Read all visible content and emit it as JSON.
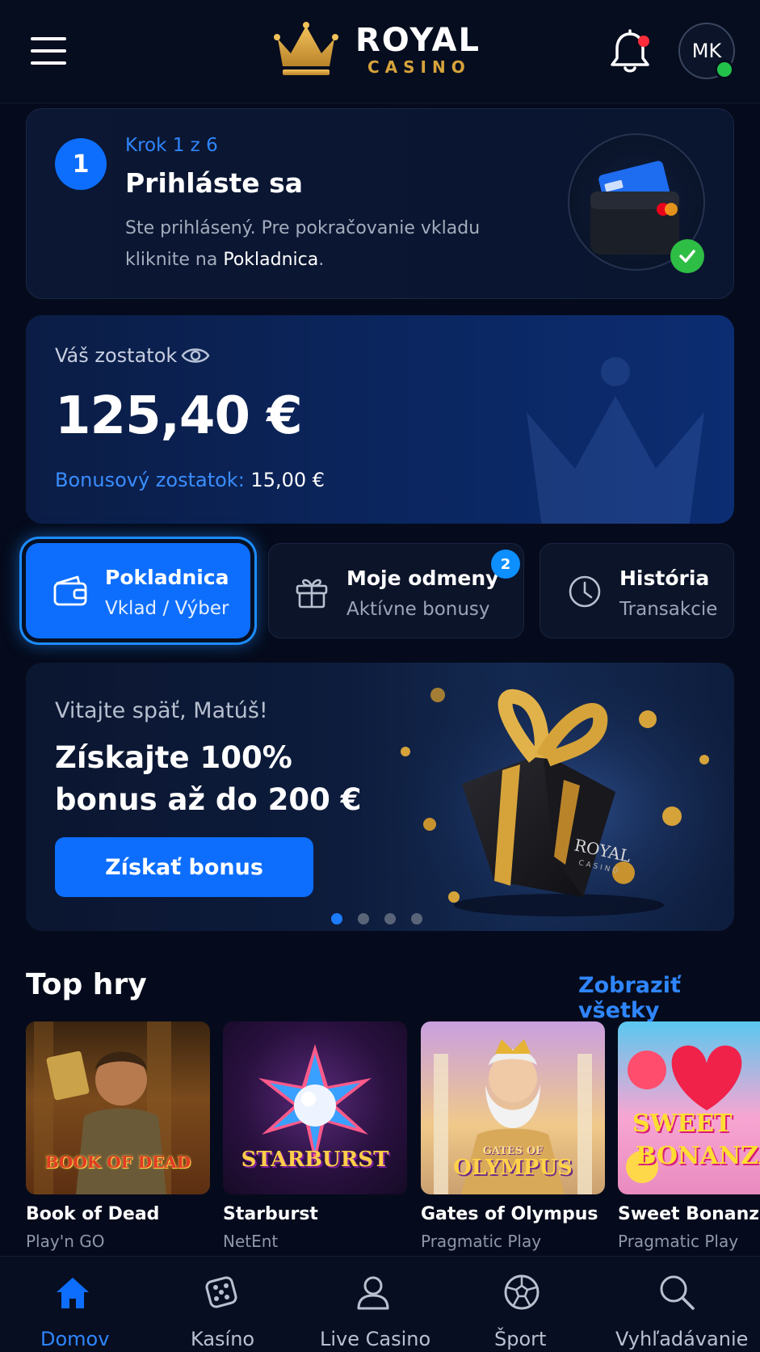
{
  "header": {
    "brand_main": "ROYAL",
    "brand_sub": "CASINO",
    "avatar_initials": "MK"
  },
  "step": {
    "number": "1",
    "label": "Krok 1 z 6",
    "title": "Prihláste sa",
    "desc_prefix": "Ste prihlásený. Pre pokračovanie vkladu kliknite na ",
    "desc_link": "Pokladnica",
    "desc_suffix": "."
  },
  "balance": {
    "label": "Váš zostatok",
    "amount": "125,40 €",
    "bonus_label": "Bonusový zostatok:",
    "bonus_amount": "15,00 €"
  },
  "actions": [
    {
      "title": "Pokladnica",
      "subtitle": "Vklad / Výber",
      "icon": "wallet-icon"
    },
    {
      "title": "Moje odmeny",
      "subtitle": "Aktívne bonusy",
      "icon": "gift-icon",
      "badge": "2"
    },
    {
      "title": "História",
      "subtitle": "Transakcie",
      "icon": "clock-icon"
    }
  ],
  "promo": {
    "welcome": "Vitajte späť, Matúš!",
    "headline": "Získajte 100% bonus až do 200 €",
    "button": "Získať bonus",
    "box_brand": "ROYAL",
    "box_brand_sub": "CASINO",
    "slides_total": 4,
    "slide_active": 1
  },
  "top_games": {
    "title": "Top hry",
    "see_all": "Zobraziť všetky",
    "games": [
      {
        "name": "Book of Dead",
        "provider": "Play'n GO",
        "logo": "BOOK OF DEAD"
      },
      {
        "name": "Starburst",
        "provider": "NetEnt",
        "logo": "STARBURST"
      },
      {
        "name": "Gates of Olympus",
        "provider": "Pragmatic Play",
        "logo_top": "GATES OF",
        "logo": "OLYMPUS"
      },
      {
        "name": "Sweet Bonanza",
        "provider": "Pragmatic Play",
        "logo_top": "SWEET",
        "logo": "BONANZA"
      }
    ]
  },
  "nav": [
    {
      "label": "Domov",
      "icon": "home-icon",
      "active": true
    },
    {
      "label": "Kasíno",
      "icon": "dice-icon"
    },
    {
      "label": "Live Casino",
      "icon": "user-icon"
    },
    {
      "label": "Šport",
      "icon": "soccer-ball-icon"
    },
    {
      "label": "Vyhľadávanie",
      "icon": "search-icon"
    }
  ],
  "colors": {
    "background": "#050b1c",
    "accent": "#0d6efd",
    "link": "#2f86ff",
    "gold": "#d6a33a",
    "success": "#2ebd45",
    "alert": "#ff2d3b"
  }
}
